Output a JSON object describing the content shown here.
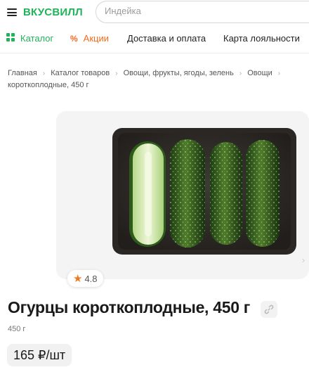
{
  "header": {
    "logo": "ВКУСВИЛЛ",
    "search_placeholder": "Индейка"
  },
  "nav": {
    "catalog": "Каталог",
    "promo": "Акции",
    "delivery": "Доставка и оплата",
    "loyalty": "Карта лояльности"
  },
  "breadcrumbs": {
    "items": [
      "Главная",
      "Каталог товаров",
      "Овощи, фрукты, ягоды, зелень",
      "Овощи"
    ],
    "current": "короткоплодные, 450 г"
  },
  "product": {
    "rating": "4.8",
    "title": "Огурцы короткоплодные, 450 г",
    "weight": "450 г",
    "price": "165 ₽/шт"
  },
  "colors": {
    "brand_green": "#1fb35a",
    "promo_orange": "#f26a1b",
    "star_orange": "#f2771a"
  },
  "icons": {
    "menu": "menu-icon",
    "catalog": "grid-icon",
    "promo": "percent-icon",
    "rating": "star-icon",
    "share": "link-icon",
    "chevron": "chevron-right-icon"
  }
}
